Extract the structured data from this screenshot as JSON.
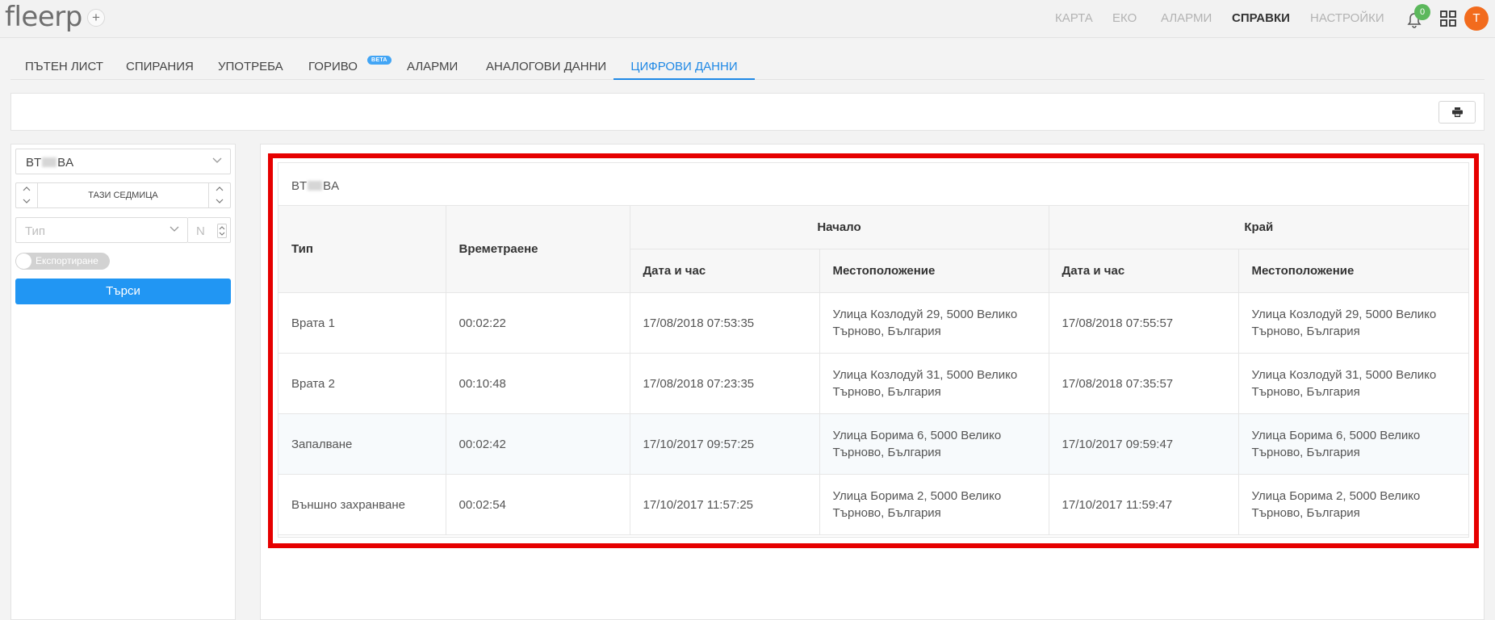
{
  "app": {
    "logo": "fleerp",
    "add_symbol": "+"
  },
  "topnav": [
    {
      "label": "КАРТА",
      "active": false
    },
    {
      "label": "ЕКО",
      "active": false
    },
    {
      "label": "АЛАРМИ",
      "active": false
    },
    {
      "label": "СПРАВКИ",
      "active": true
    },
    {
      "label": "НАСТРОЙКИ",
      "active": false
    }
  ],
  "notifications": {
    "count": "0",
    "icon": "bell-icon"
  },
  "apps_icon": "grid-icon",
  "user": {
    "avatar_letter": "T",
    "avatar_color": "#f26b1d"
  },
  "tabs": [
    {
      "label": "ПЪТЕН ЛИСТ",
      "active": false
    },
    {
      "label": "СПИРАНИЯ",
      "active": false
    },
    {
      "label": "УПОТРЕБА",
      "active": false
    },
    {
      "label": "ГОРИВО",
      "active": false,
      "badge": "BETA"
    },
    {
      "label": "АЛАРМИ",
      "active": false
    },
    {
      "label": "АНАЛОГОВИ ДАННИ",
      "active": false
    },
    {
      "label": "ЦИФРОВИ ДАННИ",
      "active": true
    }
  ],
  "toolbar": {
    "print_icon": "printer-icon"
  },
  "filters": {
    "vehicle": {
      "prefix": "BT",
      "suffix": "BA"
    },
    "period": "ТАЗИ СЕДМИЦА",
    "type_placeholder": "Тип",
    "number_placeholder": "N",
    "export_label": "Експортиране",
    "export_enabled": false,
    "search_label": "Търси"
  },
  "report": {
    "vehicle_prefix": "BT",
    "vehicle_suffix": "BA",
    "headers": {
      "type": "Тип",
      "duration": "Времетраене",
      "start": "Начало",
      "end": "Край",
      "datetime": "Дата и час",
      "location": "Местоположение"
    },
    "rows": [
      {
        "type": "Врата 1",
        "duration": "00:02:22",
        "start_time": "17/08/2018 07:53:35",
        "start_location": "Улица Козлодуй 29, 5000 Велико Търново, България",
        "end_time": "17/08/2018 07:55:57",
        "end_location": "Улица Козлодуй 29, 5000 Велико Търново, България"
      },
      {
        "type": "Врата 2",
        "duration": "00:10:48",
        "start_time": "17/08/2018 07:23:35",
        "start_location": "Улица Козлодуй 31, 5000 Велико Търново, България",
        "end_time": "17/08/2018 07:35:57",
        "end_location": "Улица Козлодуй 31, 5000 Велико Търново, България"
      },
      {
        "type": "Запалване",
        "duration": "00:02:42",
        "start_time": "17/10/2017 09:57:25",
        "start_location": "Улица Борима 6, 5000 Велико Търново, България",
        "end_time": "17/10/2017 09:59:47",
        "end_location": "Улица Борима 6, 5000 Велико Търново, България"
      },
      {
        "type": "Външно захранване",
        "duration": "00:02:54",
        "start_time": "17/10/2017 11:57:25",
        "start_location": "Улица Борима 2, 5000 Велико Търново, България",
        "end_time": "17/10/2017 11:59:47",
        "end_location": "Улица Борима 2, 5000 Велико Търново, България"
      }
    ]
  },
  "colors": {
    "accent": "#1e88e5",
    "highlight": "#e60000",
    "button": "#2196f3",
    "badge": "#5cb85c"
  }
}
